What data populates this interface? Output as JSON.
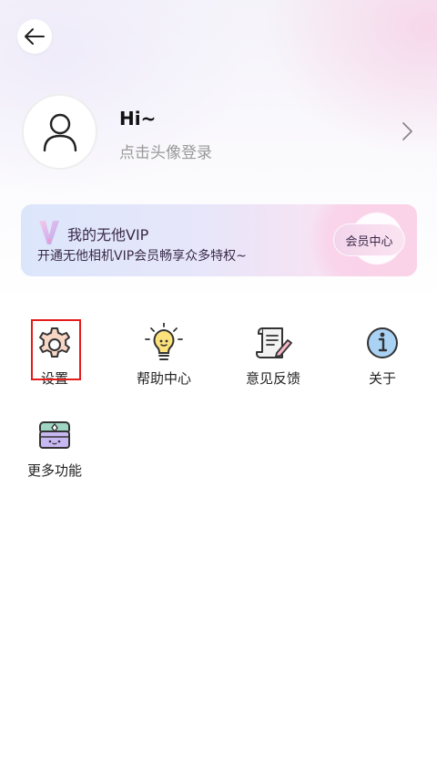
{
  "header": {
    "back_icon": "arrow-left-icon"
  },
  "profile": {
    "greeting": "Hi~",
    "login_hint": "点击头像登录",
    "avatar_icon": "user-outline-icon",
    "chevron_icon": "chevron-right-icon"
  },
  "vip": {
    "title": "我的无他VIP",
    "subtitle": "开通无他相机VIP会员畅享众多特权~",
    "button_label": "会员中心",
    "logo_icon": "vip-v-logo-icon"
  },
  "functions": [
    {
      "label": "设置",
      "icon": "settings-gear-icon"
    },
    {
      "label": "帮助中心",
      "icon": "lightbulb-icon"
    },
    {
      "label": "意见反馈",
      "icon": "feedback-scroll-icon"
    },
    {
      "label": "关于",
      "icon": "info-icon"
    },
    {
      "label": "更多功能",
      "icon": "treasure-chest-icon"
    }
  ],
  "colors": {
    "highlight_box": "#e51c1c",
    "vip_text": "#3a2a4a",
    "hint_text": "#999999"
  }
}
